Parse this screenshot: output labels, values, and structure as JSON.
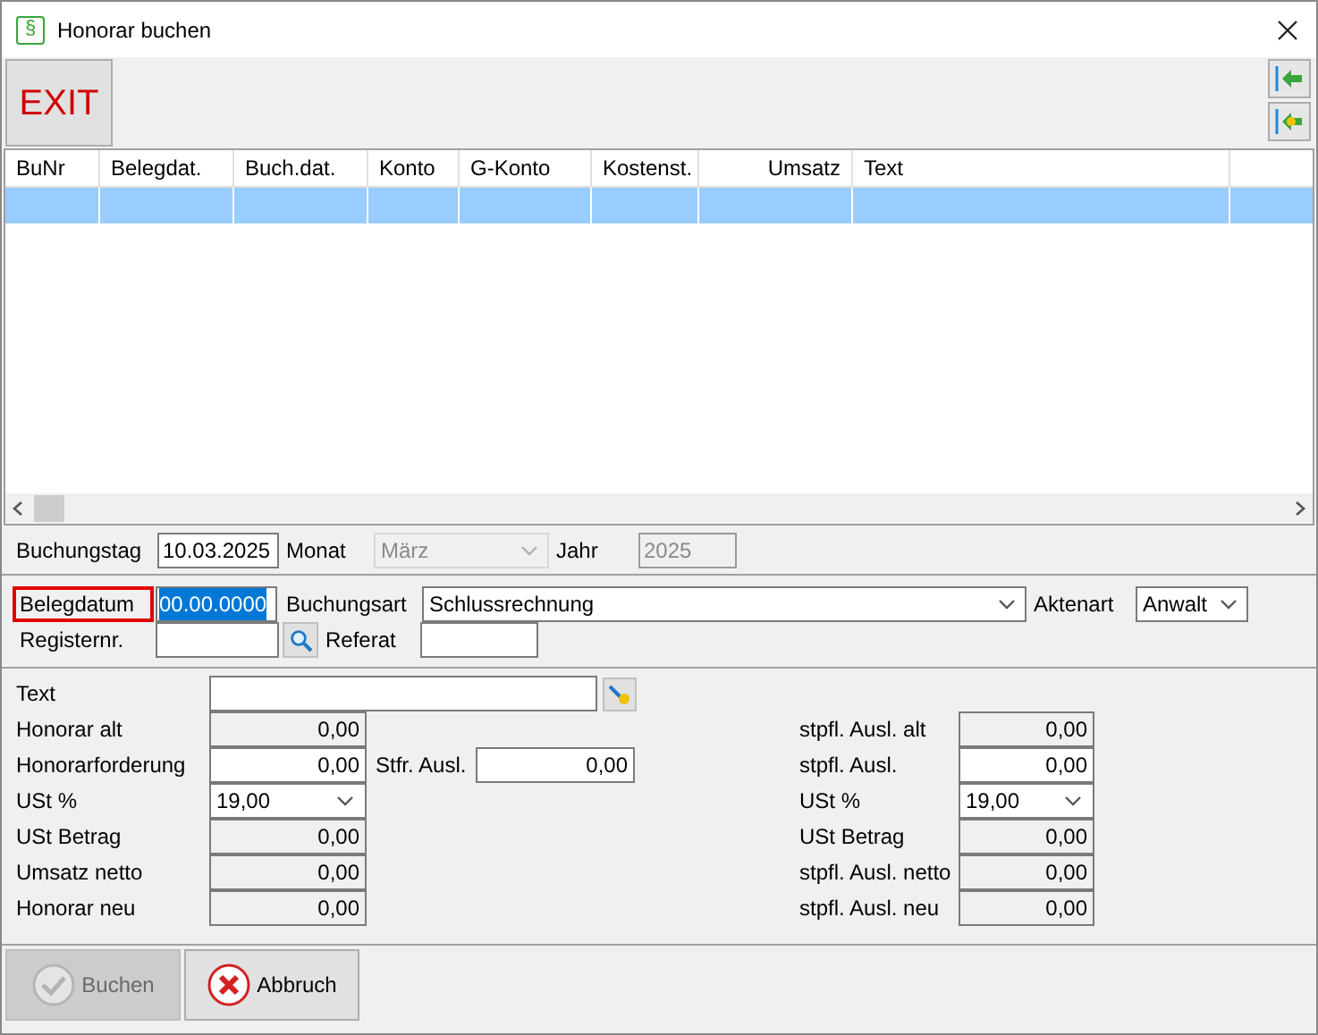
{
  "window": {
    "icon": "§",
    "title": "Honorar buchen"
  },
  "toolbar": {
    "exit": "EXIT"
  },
  "table": {
    "columns": [
      {
        "label": "BuNr"
      },
      {
        "label": "Belegdat."
      },
      {
        "label": "Buch.dat."
      },
      {
        "label": "Konto"
      },
      {
        "label": "G-Konto"
      },
      {
        "label": "Kostenst."
      },
      {
        "label": "Umsatz"
      },
      {
        "label": "Text"
      }
    ],
    "rows": [
      {
        "selected": true
      }
    ]
  },
  "date_row": {
    "buchungstag_label": "Buchungstag",
    "buchungstag": "10.03.2025",
    "monat_label": "Monat",
    "monat": "März",
    "monat_disabled": true,
    "jahr_label": "Jahr",
    "jahr": "2025",
    "jahr_disabled": true
  },
  "booking": {
    "belegdatum_label": "Belegdatum",
    "belegdatum_highlighted": true,
    "belegdatum": "00.00.0000",
    "belegdatum_text_selected": true,
    "buchungsart_label": "Buchungsart",
    "buchungsart": "Schlussrechnung",
    "aktenart_label": "Aktenart",
    "aktenart": "Anwalt",
    "registernr_label": "Registernr.",
    "referat_label": "Referat"
  },
  "text_field": {
    "label": "Text"
  },
  "left_fields": [
    {
      "label": "Honorar alt",
      "kind": "readonly",
      "value": "0,00"
    },
    {
      "label": "Honorarforderung",
      "kind": "input",
      "value": "0,00"
    },
    {
      "label": "USt %",
      "kind": "select",
      "value": "19,00"
    },
    {
      "label": "USt Betrag",
      "kind": "readonly",
      "value": "0,00"
    },
    {
      "label": "Umsatz netto",
      "kind": "readonly",
      "value": "0,00"
    },
    {
      "label": "Honorar neu",
      "kind": "readonly",
      "value": "0,00"
    }
  ],
  "middle_field": {
    "label": "Stfr. Ausl.",
    "value": "0,00"
  },
  "right_fields": [
    {
      "label": "stpfl. Ausl. alt",
      "kind": "readonly",
      "value": "0,00"
    },
    {
      "label": "stpfl. Ausl.",
      "kind": "input",
      "value": "0,00"
    },
    {
      "label": "USt %",
      "kind": "select",
      "value": "19,00"
    },
    {
      "label": "USt Betrag",
      "kind": "readonly",
      "value": "0,00"
    },
    {
      "label": "stpfl. Ausl. netto",
      "kind": "readonly",
      "value": "0,00"
    },
    {
      "label": "stpfl. Ausl. neu",
      "kind": "readonly",
      "value": "0,00"
    }
  ],
  "buttons": [
    {
      "label": "Buchen",
      "disabled": true
    },
    {
      "label": "Abbruch",
      "disabled": false
    }
  ]
}
